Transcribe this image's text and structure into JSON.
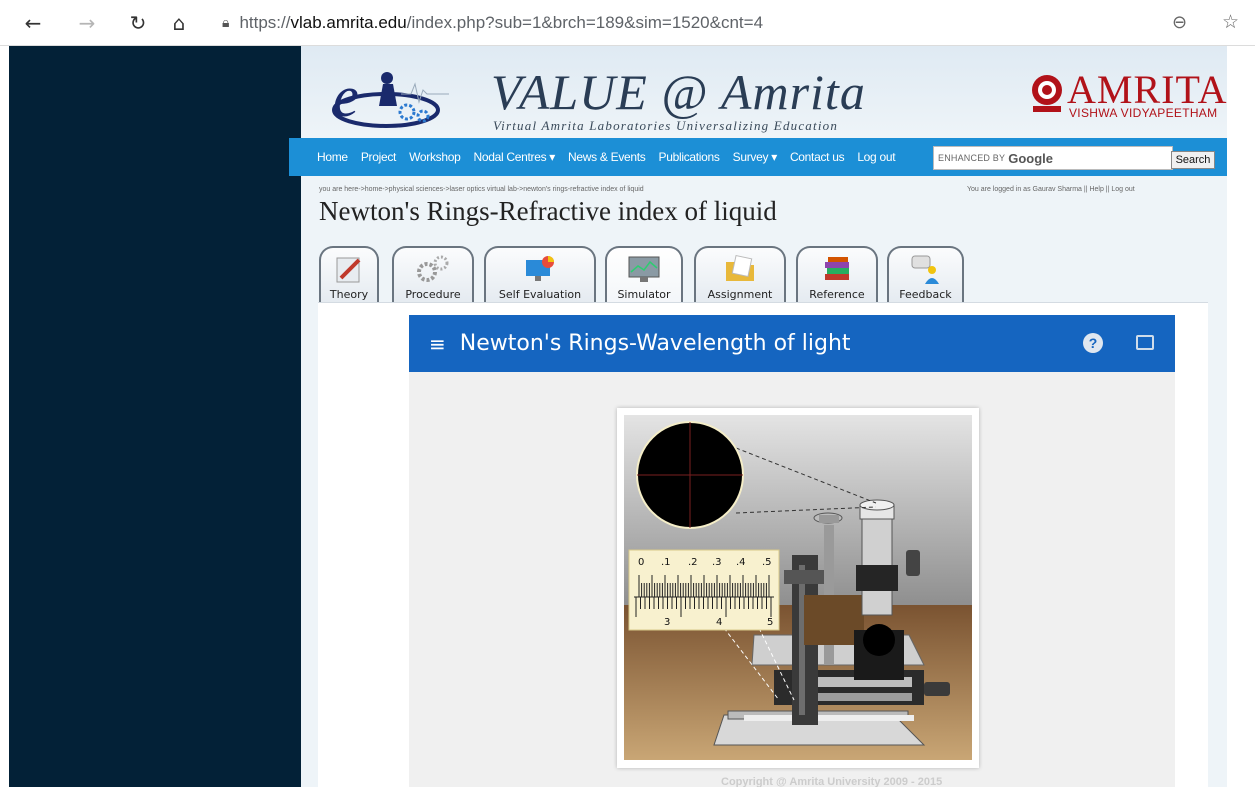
{
  "browser": {
    "url_prefix": "https://",
    "url_host": "vlab.amrita.edu",
    "url_path": "/index.php?sub=1&brch=189&sim=1520&cnt=4",
    "icons": [
      "back-arrow-icon",
      "forward-arrow-icon",
      "refresh-icon",
      "home-icon",
      "lock-icon",
      "zoom-out-icon",
      "favorites-icon"
    ]
  },
  "header": {
    "title": "VALUE @ Amrita",
    "subtitle": "Virtual Amrita Laboratories Universalizing Education",
    "brand_name": "AMRITA",
    "brand_sub": "VISHWA VIDYAPEETHAM"
  },
  "nav": {
    "items": [
      "Home",
      "Project",
      "Workshop",
      "Nodal Centres ▾",
      "News & Events",
      "Publications",
      "Survey ▾",
      "Contact us",
      "Log out"
    ],
    "search_prefix": "ENHANCED BY",
    "search_brand": "Google",
    "search_button": "Search"
  },
  "breadcrumb": "you are here->home->physical sciences->laser optics virtual lab->newton's rings-refractive index of liquid",
  "login_info": "You are logged in as  Gaurav Sharma  ||  Help  ||  Log out",
  "page_title": "Newton's Rings-Refractive index of liquid",
  "tabs": [
    {
      "label": "Theory"
    },
    {
      "label": "Procedure"
    },
    {
      "label": "Self Evaluation"
    },
    {
      "label": "Simulator"
    },
    {
      "label": "Assignment"
    },
    {
      "label": "Reference"
    },
    {
      "label": "Feedback"
    }
  ],
  "active_tab": "Simulator",
  "simulator": {
    "title": "Newton's Rings-Wavelength of light",
    "help_label": "?",
    "scale_top": [
      "0",
      ".1",
      ".2",
      ".3",
      ".4",
      ".5"
    ],
    "scale_bottom": [
      "3",
      "4",
      "5"
    ]
  },
  "copyright": "Copyright @ Amrita University 2009 - 2015",
  "colors": {
    "page_bg": "#032137",
    "nav_bar": "#1c8fd6",
    "app_bar": "#1565c0",
    "brand_red": "#b11219"
  }
}
